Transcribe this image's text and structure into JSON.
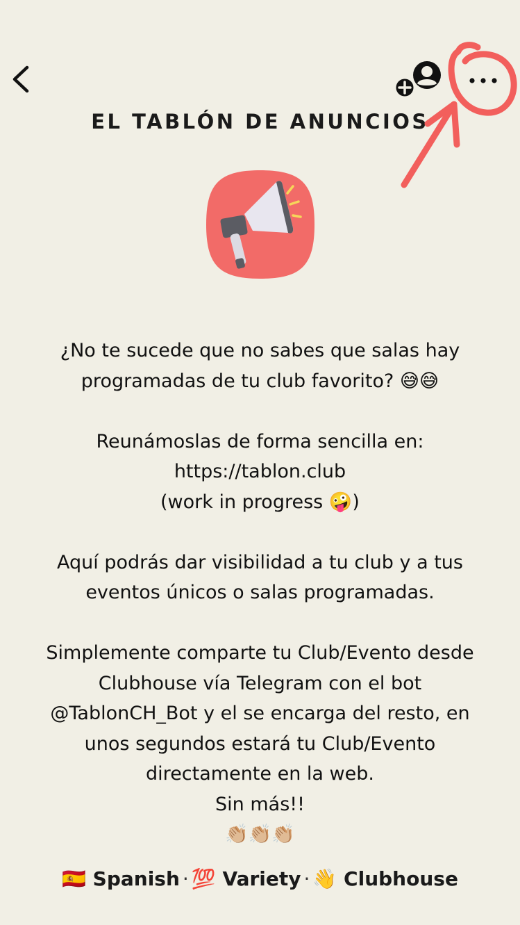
{
  "header": {
    "title": "EL TABLÓN DE ANUNCIOS"
  },
  "icons": {
    "back": "chevron-left-icon",
    "invite": "add-person-icon",
    "more": "more-dots-icon",
    "club": "megaphone-icon"
  },
  "colors": {
    "background": "#f1efe5",
    "club_icon_bg": "#f26b68",
    "annotation": "#f25f5c"
  },
  "description": {
    "p1_line1": "¿No te sucede que no sabes que salas hay",
    "p1_line2": "programadas de tu club favorito? 😅😅",
    "p2_line1": "Reunámoslas de forma sencilla en:",
    "p2_line2": "https://tablon.club",
    "p2_line3": "(work in progress 🤪)",
    "p3_line1": "Aquí podrás dar visibilidad a tu club y a tus",
    "p3_line2": "eventos únicos o salas programadas.",
    "p4_line1": "Simplemente comparte tu Club/Evento desde",
    "p4_line2": "Clubhouse vía Telegram con el bot",
    "p4_line3": "@TablonCH_Bot y el se encarga del resto, en",
    "p4_line4": "unos segundos estará tu Club/Evento",
    "p4_line5": "directamente en la web.",
    "p4_line6": "Sin más!!",
    "p4_line7": "👏🏼👏🏼👏🏼"
  },
  "tags": [
    {
      "emoji": "🇪🇸",
      "label": "Spanish"
    },
    {
      "emoji": "💯",
      "label": "Variety"
    },
    {
      "emoji": "👋",
      "label": "Clubhouse"
    }
  ],
  "tag_separator": "·"
}
